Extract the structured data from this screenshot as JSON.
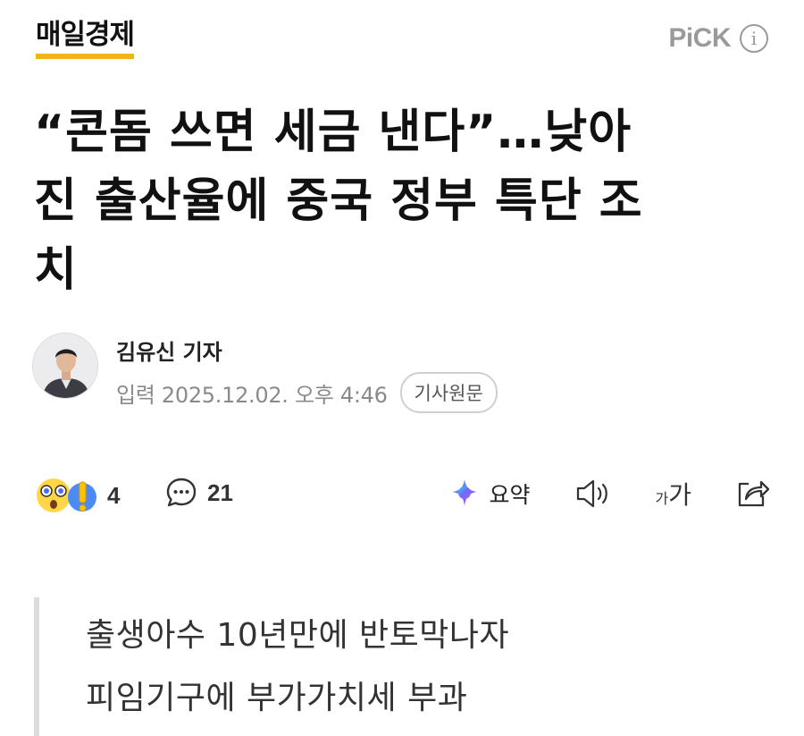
{
  "header": {
    "press_name": "매일경제",
    "press_underline_color": "#f1b51b",
    "pick_label": "PiCK",
    "info_icon": "info-circle-icon",
    "info_glyph": "i"
  },
  "article": {
    "headline_line1": "“콘돔 쓰면 세금 낸다”…낮아",
    "headline_line2": "진 출산율에 중국 정부 특단 조",
    "headline_line3": "치",
    "reporter_name": "김유신 기자",
    "published": "입력 2025.12.02. 오후 4:46",
    "original_link_label": "기사원문"
  },
  "toolbar": {
    "reaction_icon": "surprised-emoji-icon",
    "reaction_count": "4",
    "comment_icon": "comment-bubble-icon",
    "comment_count": "21",
    "summary_icon": "ai-sparkle-icon",
    "summary_label": "요약",
    "tts_icon": "speaker-icon",
    "font_size_small": "가",
    "font_size_big": "가",
    "share_icon": "share-icon"
  },
  "subheadline": {
    "line1": "출생아수 10년만에 반토막나자",
    "line2": "피임기구에 부가가치세 부과"
  },
  "colors": {
    "accent": "#f1b51b",
    "muted": "#8a8a8a",
    "text": "#111111"
  }
}
